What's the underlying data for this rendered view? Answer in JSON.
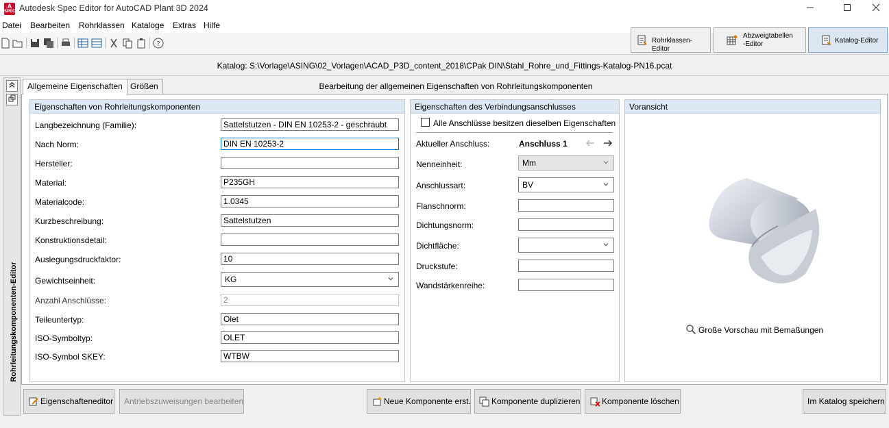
{
  "window": {
    "icon_label": "A",
    "icon_sub": "SPEC",
    "title": "Autodesk Spec Editor for AutoCAD Plant 3D 2024"
  },
  "menu": [
    "Datei",
    "Bearbeiten",
    "Rohrklassen",
    "Kataloge",
    "Extras",
    "Hilfe"
  ],
  "mode_tabs": [
    {
      "label": "Rohrklassen-Editor",
      "icon": "spec-editor-icon"
    },
    {
      "label_line1": "Abzweigtabellen",
      "label_line2": "-Editor",
      "icon": "branch-table-icon"
    },
    {
      "label": "Katalog-Editor",
      "icon": "catalog-editor-icon",
      "active": true
    }
  ],
  "catalog_path": "Katalog: S:\\Vorlage\\ASING\\02_Vorlagen\\ACAD_P3D_content_2018\\CPak DIN\\Stahl_Rohre_und_Fittings-Katalog-PN16.pcat",
  "side_label": "Rohrleitungskomponenten-Editor",
  "tabs": [
    "Allgemeine Eigenschaften",
    "Größen"
  ],
  "tab_caption": "Bearbeitung der allgemeinen Eigenschaften von Rohrleitungskomponenten",
  "component_props": {
    "header": "Eigenschaften von Rohrleitungskomponenten",
    "fields": [
      {
        "label": "Langbezeichnung (Familie):",
        "value": "Sattelstutzen - DIN EN 10253-2 - geschraubt"
      },
      {
        "label": "Nach Norm:",
        "value": "DIN EN 10253-2"
      },
      {
        "label": "Hersteller:",
        "value": ""
      },
      {
        "label": "Material:",
        "value": "P235GH"
      },
      {
        "label": "Materialcode:",
        "value": "1.0345"
      },
      {
        "label": "Kurzbeschreibung:",
        "value": "Sattelstutzen"
      },
      {
        "label": "Konstruktionsdetail:",
        "value": ""
      },
      {
        "label": "Auslegungsdruckfaktor:",
        "value": "10"
      },
      {
        "label": "Gewichtseinheit:",
        "value": "KG"
      },
      {
        "label": "Anzahl Anschlüsse:",
        "value": "2"
      },
      {
        "label": "Teileuntertyp:",
        "value": "Olet"
      },
      {
        "label": "ISO-Symboltyp:",
        "value": "OLET"
      },
      {
        "label": "ISO-Symbol SKEY:",
        "value": "WTBW"
      }
    ]
  },
  "connection_props": {
    "header": "Eigenschaften des Verbindungsanschlusses",
    "same_props_label": "Alle Anschlüsse besitzen dieselben Eigenschaften",
    "same_props_checked": false,
    "current_label": "Aktueller Anschluss:",
    "current_value": "Anschluss 1",
    "fields": [
      {
        "label": "Nenneinheit:",
        "value": "Mm"
      },
      {
        "label": "Anschlussart:",
        "value": "BV"
      },
      {
        "label": "Flanschnorm:",
        "value": ""
      },
      {
        "label": "Dichtungsnorm:",
        "value": ""
      },
      {
        "label": "Dichtfläche:",
        "value": ""
      },
      {
        "label": "Druckstufe:",
        "value": ""
      },
      {
        "label": "Wandstärkenreihe:",
        "value": ""
      }
    ]
  },
  "preview": {
    "header": "Voransicht",
    "large_preview_label": "Große Vorschau mit Bemaßungen"
  },
  "buttons": {
    "properties_editor": "Eigenschafteneditor",
    "drive_assignments": "Antriebszuweisungen bearbeiten",
    "new_component": "Neue Komponente erst.",
    "duplicate_component": "Komponente duplizieren",
    "delete_component": "Komponente löschen",
    "save_catalog": "Im Katalog speichern"
  },
  "colors": {
    "group_header": "#dde8f5",
    "active_tab": "#dce6f3",
    "focus_border": "#0078d7",
    "app_red": "#c8102e"
  }
}
